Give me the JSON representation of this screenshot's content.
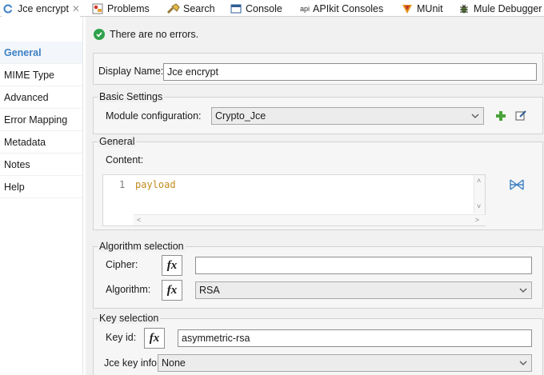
{
  "tabs": [
    {
      "label": "Jce encrypt",
      "icon": "mule-component-icon",
      "active": true,
      "closable": true
    },
    {
      "label": "Problems",
      "icon": "problems-icon"
    },
    {
      "label": "Search",
      "icon": "search-flashlight-icon"
    },
    {
      "label": "Console",
      "icon": "console-icon"
    },
    {
      "label": "APIkit Consoles",
      "icon": "api-icon",
      "icon_text": "api"
    },
    {
      "label": "MUnit",
      "icon": "munit-icon"
    },
    {
      "label": "Mule Debugger",
      "icon": "debugger-bug-icon"
    }
  ],
  "nav": {
    "items": [
      "General",
      "MIME Type",
      "Advanced",
      "Error Mapping",
      "Metadata",
      "Notes",
      "Help"
    ],
    "selected": "General"
  },
  "status": {
    "text": "There are no errors."
  },
  "display_name": {
    "label": "Display Name:",
    "value": "Jce encrypt"
  },
  "basic_settings": {
    "title": "Basic Settings",
    "module_config_label": "Module configuration:",
    "module_config_value": "Crypto_Jce"
  },
  "general": {
    "title": "General",
    "content_label": "Content:",
    "line_number": "1",
    "code": "payload"
  },
  "algorithm_selection": {
    "title": "Algorithm selection",
    "cipher_label": "Cipher:",
    "cipher_value": "",
    "algorithm_label": "Algorithm:",
    "algorithm_value": "RSA"
  },
  "key_selection": {
    "title": "Key selection",
    "key_id_label": "Key id:",
    "key_id_value": "asymmetric-rsa",
    "jce_key_info_label": "Jce key info",
    "jce_key_info_value": "None"
  },
  "fx_label": "fx",
  "colors": {
    "accent": "#3d80c4",
    "success": "#2ea24a",
    "code": "#c28a1b"
  }
}
